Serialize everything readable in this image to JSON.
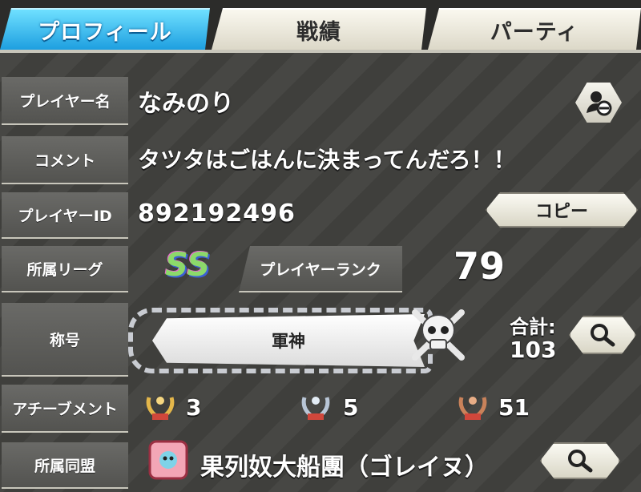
{
  "tabs": [
    {
      "label": "プロフィール",
      "active": true
    },
    {
      "label": "戦績",
      "active": false
    },
    {
      "label": "パーティ",
      "active": false
    }
  ],
  "rows": {
    "player_name": {
      "label": "プレイヤー名",
      "value": "なみのり"
    },
    "comment": {
      "label": "コメント",
      "value": "タツタはごはんに決まってんだろ！！"
    },
    "player_id": {
      "label": "プレイヤーID",
      "value": "892192496",
      "copy_button": "コピー"
    },
    "league": {
      "label": "所属リーグ",
      "badge": "SS"
    },
    "rank": {
      "label": "プレイヤーランク",
      "value": "79"
    },
    "title": {
      "label": "称号",
      "value": "軍神",
      "total_label": "合計:",
      "total_value": "103"
    },
    "achievement": {
      "label": "アチーブメント",
      "gold": "3",
      "silver": "5",
      "bronze": "51"
    },
    "alliance": {
      "label": "所属同盟",
      "value": "果列奴大船團（ゴレイヌ）"
    }
  },
  "colors": {
    "active_tab": "#1e9fe0",
    "gold": "#e3b64a",
    "silver": "#b9c6d6",
    "bronze": "#c9825a"
  }
}
